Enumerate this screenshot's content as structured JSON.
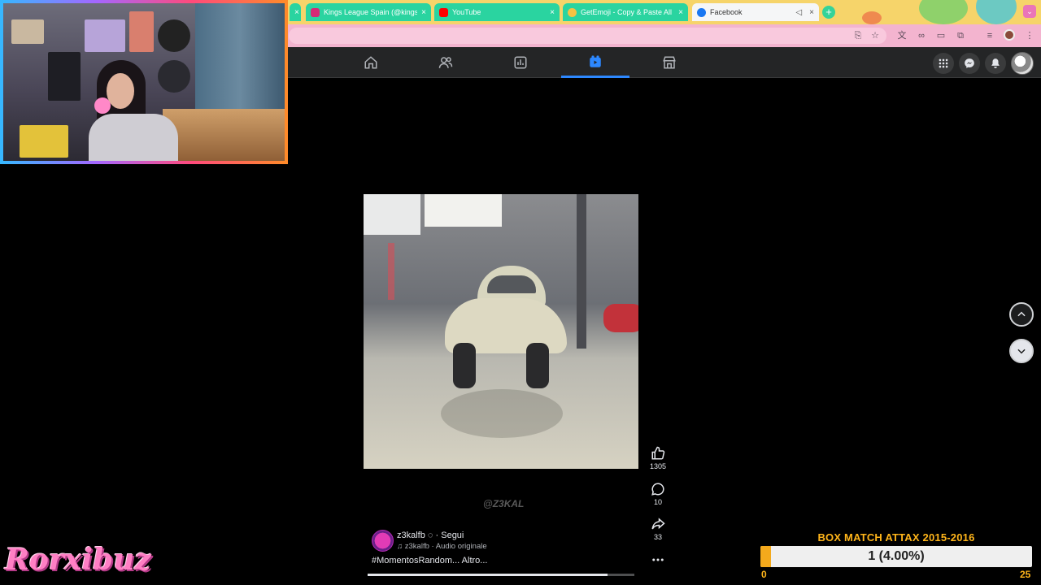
{
  "browser": {
    "tabs": [
      {
        "title": "Kings League Spain (@kingsl",
        "icon": "instagram-icon",
        "color": "#d62976",
        "active": false
      },
      {
        "title": "YouTube",
        "icon": "youtube-icon",
        "color": "#ff0000",
        "active": false
      },
      {
        "title": "GetEmoji - Copy & Paste All",
        "icon": "emoji-icon",
        "color": "#f5c242",
        "active": false
      },
      {
        "title": "Facebook",
        "icon": "facebook-icon",
        "color": "#1877f2",
        "active": true
      }
    ],
    "new_tab_label": "+"
  },
  "fb_nav": {
    "items": [
      {
        "name": "home",
        "icon": "home-icon",
        "active": false
      },
      {
        "name": "friends",
        "icon": "friends-icon",
        "active": false
      },
      {
        "name": "dashboard",
        "icon": "dashboard-icon",
        "active": false
      },
      {
        "name": "video",
        "icon": "video-icon",
        "active": true
      },
      {
        "name": "marketplace",
        "icon": "marketplace-icon",
        "active": false
      }
    ],
    "accent": "#2d88ff"
  },
  "reel": {
    "watermark": "@Z3KAL",
    "likes": "1305",
    "comments": "10",
    "shares": "33",
    "author": "z3kalfb",
    "follow": "Segui",
    "audio": "z3kalfb · Audio originale",
    "caption": "#MomentosRandom... Altro...",
    "progress": 0.9
  },
  "overlay": {
    "streamer_name": "Rorxibuz",
    "goal_title": "BOX MATCH ATTAX 2015-2016",
    "goal_value_text": "1 (4.00%)",
    "goal_min": "0",
    "goal_max": "25",
    "goal_fraction": 0.04,
    "goal_color": "#ffb51a"
  }
}
